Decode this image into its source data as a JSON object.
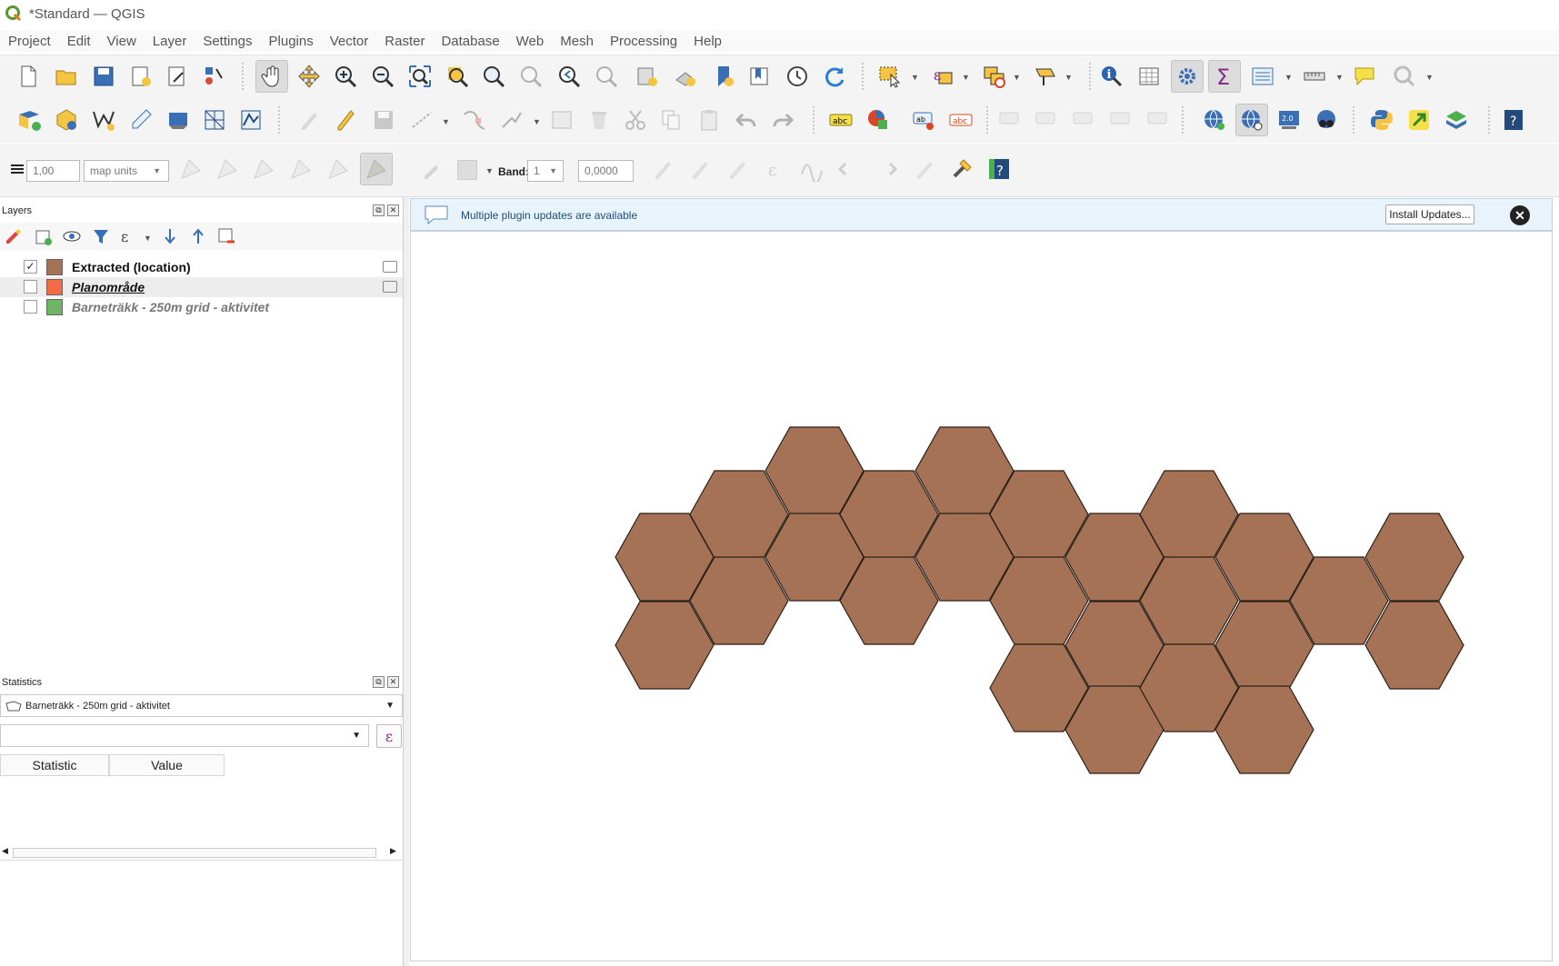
{
  "window": {
    "title": "*Standard — QGIS"
  },
  "menu": [
    "Project",
    "Edit",
    "View",
    "Layer",
    "Settings",
    "Plugins",
    "Vector",
    "Raster",
    "Database",
    "Web",
    "Mesh",
    "Processing",
    "Help"
  ],
  "toolbar3": {
    "stroke_width": "1,00",
    "units": "map units",
    "band_label": "Band:",
    "band_value": "1",
    "value": "0,0000"
  },
  "layers_panel": {
    "title": "Layers",
    "layers": [
      {
        "name": "Extracted (location)",
        "checked": true,
        "color": "#a57256",
        "style": "bold"
      },
      {
        "name": "Planområde",
        "checked": false,
        "color": "#f36c45",
        "style": "bold-italic-underline"
      },
      {
        "name": "Barneträkk - 250m grid - aktivitet",
        "checked": false,
        "color": "#6fb465",
        "style": "bold-italic-gray"
      }
    ]
  },
  "statistics_panel": {
    "title": "Statistics",
    "layer": "Barneträkk - 250m grid - aktivitet",
    "field": "",
    "columns": [
      "Statistic",
      "Value"
    ]
  },
  "notification": {
    "message": "Multiple plugin updates are available",
    "button": "Install Updates..."
  },
  "colors": {
    "hex_fill": "#a57256",
    "hex_stroke": "#2a2018",
    "accent": "#1d4f7c"
  }
}
